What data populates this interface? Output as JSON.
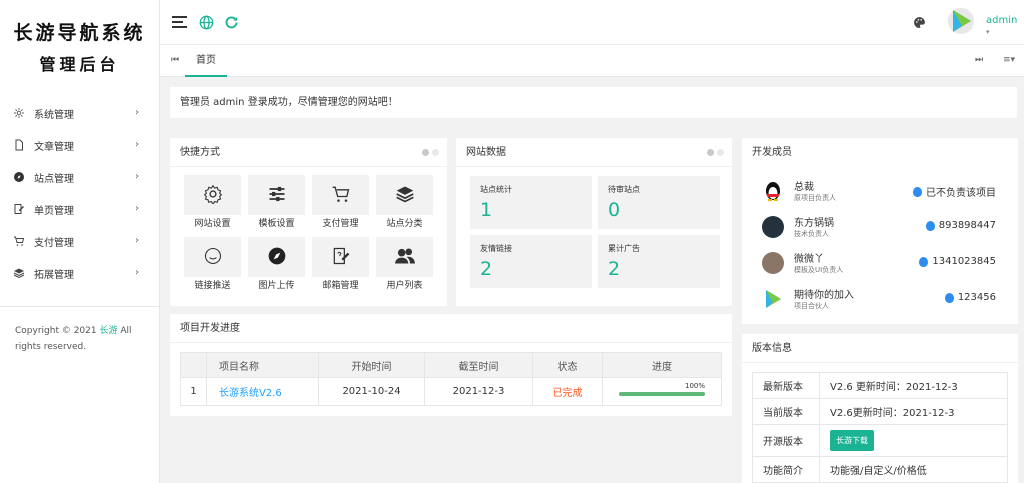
{
  "sidebar": {
    "logo_line1": "长游导航系统",
    "logo_line2": "管理后台",
    "items": [
      {
        "label": "系统管理",
        "icon": "gear-icon"
      },
      {
        "label": "文章管理",
        "icon": "document-icon"
      },
      {
        "label": "站点管理",
        "icon": "compass-icon"
      },
      {
        "label": "单页管理",
        "icon": "edit-page-icon"
      },
      {
        "label": "支付管理",
        "icon": "cart-icon"
      },
      {
        "label": "拓展管理",
        "icon": "layers-icon"
      }
    ],
    "copyright_prefix": "Copyright © 2021",
    "copyright_link": "长游",
    "copyright_suffix": "All rights reserved."
  },
  "header": {
    "username": "admin",
    "accent": "#1ab394"
  },
  "tabs": {
    "home_label": "首页"
  },
  "notice": "管理员 admin 登录成功，尽情管理您的网站吧！",
  "shortcuts": {
    "title": "快捷方式",
    "items": [
      {
        "label": "网站设置",
        "icon": "gear-icon"
      },
      {
        "label": "模板设置",
        "icon": "sliders-icon"
      },
      {
        "label": "支付管理",
        "icon": "cart-icon"
      },
      {
        "label": "站点分类",
        "icon": "layers-icon"
      },
      {
        "label": "链接推送",
        "icon": "smile-icon"
      },
      {
        "label": "图片上传",
        "icon": "compass-icon"
      },
      {
        "label": "邮箱管理",
        "icon": "edit-page-icon"
      },
      {
        "label": "用户列表",
        "icon": "users-icon"
      }
    ]
  },
  "site_data": {
    "title": "网站数据",
    "stats": [
      {
        "label": "站点统计",
        "value": "1"
      },
      {
        "label": "待审站点",
        "value": "0"
      },
      {
        "label": "友情链接",
        "value": "2"
      },
      {
        "label": "累计广告",
        "value": "2"
      }
    ]
  },
  "team": {
    "title": "开发成员",
    "members": [
      {
        "name": "总裁",
        "role": "原项目负责人",
        "contact": "已不负责该项目"
      },
      {
        "name": "东方锅锅",
        "role": "技术负责人",
        "contact": "893898447"
      },
      {
        "name": "微微丫",
        "role": "模板及UI负责人",
        "contact": "1341023845"
      },
      {
        "name": "期待你的加入",
        "role": "项目合伙人",
        "contact": "123456"
      }
    ]
  },
  "progress": {
    "title": "项目开发进度",
    "columns": [
      "项目名称",
      "开始时间",
      "截至时间",
      "状态",
      "进度"
    ],
    "rows": [
      {
        "index": "1",
        "name": "长游系统V2.6",
        "start": "2021-10-24",
        "end": "2021-12-3",
        "status": "已完成",
        "percent_label": "100%",
        "percent": 100
      }
    ]
  },
  "version": {
    "title": "版本信息",
    "rows": [
      {
        "key": "最新版本",
        "value": "V2.6 更新时间：2021-12-3"
      },
      {
        "key": "当前版本",
        "value": "V2.6更新时间：2021-12-3"
      },
      {
        "key": "开源版本",
        "button": "长游下载"
      },
      {
        "key": "功能简介",
        "value": "功能强/自定义/价格低"
      }
    ]
  }
}
